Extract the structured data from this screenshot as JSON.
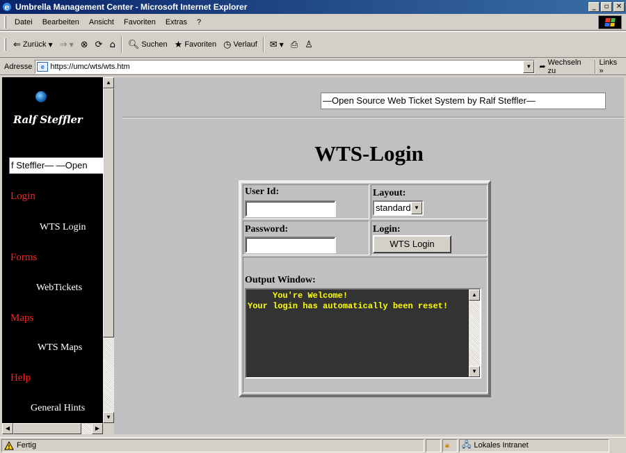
{
  "window": {
    "title": "Umbrella Management Center - Microsoft Internet Explorer"
  },
  "menu": [
    "Datei",
    "Bearbeiten",
    "Ansicht",
    "Favoriten",
    "Extras",
    "?"
  ],
  "toolbar": {
    "back": "Zurück",
    "search": "Suchen",
    "favorites": "Favoriten",
    "history": "Verlauf"
  },
  "address": {
    "label": "Adresse",
    "url": "https://umc/wts/wts.htm",
    "go": "Wechseln zu",
    "links": "Links"
  },
  "sidebar": {
    "logo_text": "Ralf Steffler",
    "marquee": "f Steffler— —Open",
    "sections": [
      {
        "heading": "Login",
        "link": "WTS Login"
      },
      {
        "heading": "Forms",
        "link": "WebTickets"
      },
      {
        "heading": "Maps",
        "link": "WTS Maps"
      },
      {
        "heading": "Help",
        "link": "General Hints"
      }
    ]
  },
  "main": {
    "banner": "—Open Source Web Ticket System by Ralf Steffler—",
    "title": "WTS-Login",
    "form": {
      "user_id_label": "User Id:",
      "user_id_value": "",
      "layout_label": "Layout:",
      "layout_value": "standard",
      "password_label": "Password:",
      "password_value": "",
      "login_label": "Login:",
      "login_button": "WTS Login",
      "output_label": "Output Window:",
      "output_text": "     You're Welcome!\nYour login has automatically been reset!"
    }
  },
  "status": {
    "text": "Fertig",
    "zone": "Lokales Intranet"
  }
}
